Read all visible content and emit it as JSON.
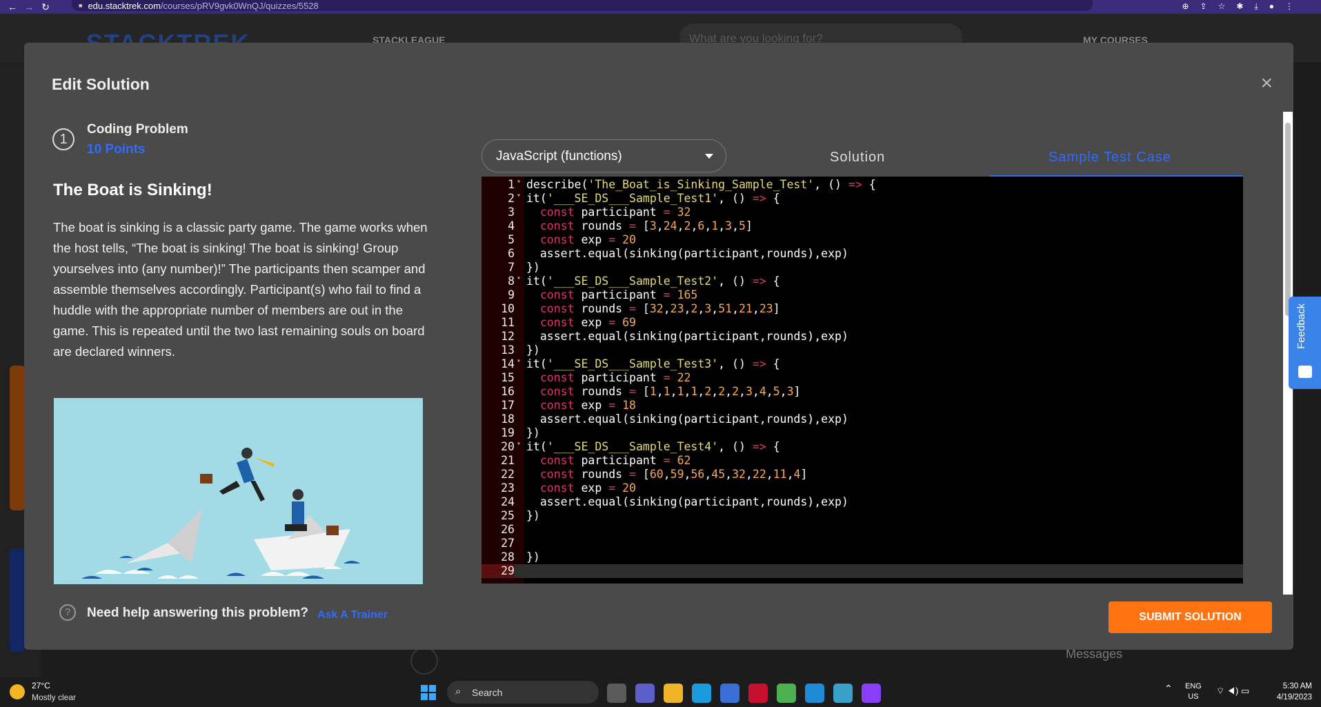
{
  "browser": {
    "url_host": "edu.stacktrek.com",
    "url_path": "/courses/pRV9gvk0WnQJ/quizzes/5528"
  },
  "background": {
    "logo": "STACKTREK",
    "league": "STACKLEAGUE",
    "search_placeholder": "What are you looking for?",
    "my_courses": "MY COURSES",
    "messages": "Messages"
  },
  "modal": {
    "title": "Edit Solution",
    "close_glyph": "×",
    "problem": {
      "number": "1",
      "type": "Coding Problem",
      "points": "10 Points",
      "title": "The Boat is Sinking!",
      "description": "The boat is sinking is a classic party game. The game works when the host tells, “The boat is sinking! The boat is sinking! Group yourselves into (any number)!” The participants then scamper and assemble themselves accordingly. Participant(s) who fail to find a huddle with the appropriate number of members are out in the game. This is repeated until the two last remaining souls on board are declared winners."
    },
    "language": "JavaScript (functions)",
    "tabs": [
      {
        "label": "Solution",
        "active": false
      },
      {
        "label": "Sample Test Case",
        "active": true
      }
    ],
    "code_lines": [
      "describe('The_Boat_is_Sinking_Sample_Test', () => {",
      "it('___SE_DS___Sample_Test1', () => {",
      "  const participant = 32",
      "  const rounds = [3,24,2,6,1,3,5]",
      "  const exp = 20",
      "  assert.equal(sinking(participant,rounds),exp)",
      "})",
      "it('___SE_DS___Sample_Test2', () => {",
      "  const participant = 165",
      "  const rounds = [32,23,2,3,51,21,23]",
      "  const exp = 69",
      "  assert.equal(sinking(participant,rounds),exp)",
      "})",
      "it('___SE_DS___Sample_Test3', () => {",
      "  const participant = 22",
      "  const rounds = [1,1,1,1,2,2,2,3,4,5,3]",
      "  const exp = 18",
      "  assert.equal(sinking(participant,rounds),exp)",
      "})",
      "it('___SE_DS___Sample_Test4', () => {",
      "  const participant = 62",
      "  const rounds = [60,59,56,45,32,22,11,4]",
      "  const exp = 20",
      "  assert.equal(sinking(participant,rounds),exp)",
      "})",
      "",
      "",
      "})",
      ""
    ],
    "fold_lines": [
      1,
      2,
      8,
      14,
      20
    ],
    "active_line": 29,
    "help_text": "Need help answering this problem?",
    "ask_trainer": "Ask A Trainer",
    "submit": "SUBMIT SOLUTION"
  },
  "feedback": "Feedback",
  "taskbar": {
    "temperature": "27°C",
    "weather": "Mostly clear",
    "search": "Search",
    "lang_1": "ENG",
    "lang_2": "US",
    "time": "5:30 AM",
    "date": "4/19/2023"
  },
  "colors": {
    "accent_blue": "#2f6bff",
    "submit_orange": "#ff7410",
    "keyword": "#e0336a",
    "string": "#e6db74",
    "number": "#ffa84a"
  }
}
